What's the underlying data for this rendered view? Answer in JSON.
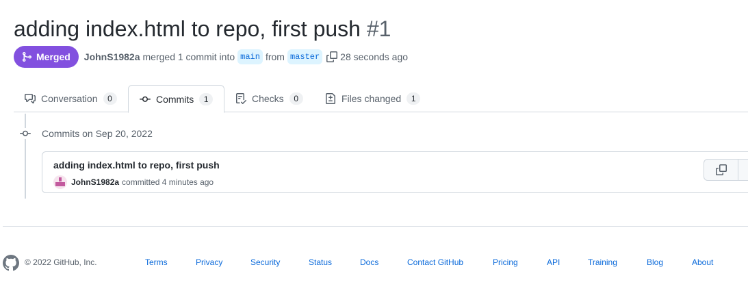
{
  "pr": {
    "title": "adding index.html to repo, first push",
    "number": "#1",
    "state_label": "Merged",
    "author": "JohnS1982a",
    "merged_text": "merged 1 commit into",
    "base_branch": "main",
    "from_text": "from",
    "head_branch": "master",
    "time": "28 seconds ago"
  },
  "tabs": [
    {
      "label": "Conversation",
      "count": "0",
      "icon": "comment-discussion-icon"
    },
    {
      "label": "Commits",
      "count": "1",
      "icon": "git-commit-icon",
      "selected": true
    },
    {
      "label": "Checks",
      "count": "0",
      "icon": "checklist-icon"
    },
    {
      "label": "Files changed",
      "count": "1",
      "icon": "file-diff-icon"
    }
  ],
  "timeline": {
    "group_heading": "Commits on Sep 20, 2022",
    "commits": [
      {
        "message": "adding index.html to repo, first push",
        "author": "JohnS1982a",
        "action": "committed 4 minutes ago"
      }
    ]
  },
  "footer": {
    "copyright": "© 2022 GitHub, Inc.",
    "links": [
      "Terms",
      "Privacy",
      "Security",
      "Status",
      "Docs",
      "Contact GitHub",
      "Pricing",
      "API",
      "Training",
      "Blog",
      "About"
    ]
  },
  "colors": {
    "merged_purple": "#8250df",
    "link_blue": "#0969da",
    "branch_bg": "#ddf4ff",
    "muted": "#57606a",
    "border": "#d0d7de"
  }
}
